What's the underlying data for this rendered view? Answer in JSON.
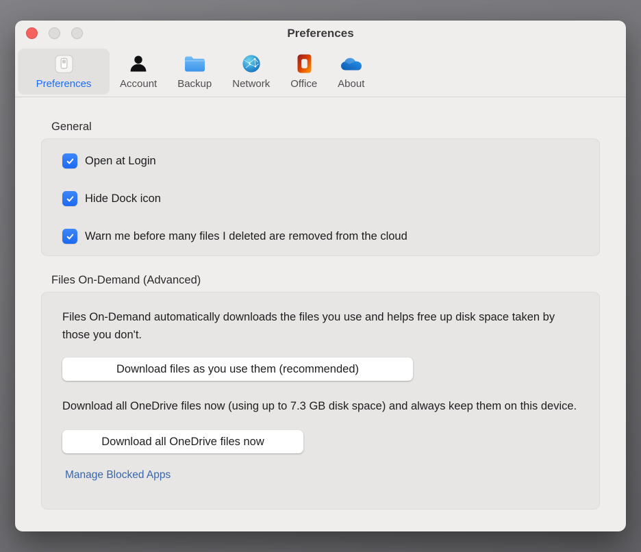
{
  "window": {
    "title": "Preferences"
  },
  "toolbar": {
    "tabs": [
      {
        "label": "Preferences",
        "icon": "switch-icon",
        "selected": true
      },
      {
        "label": "Account",
        "icon": "person-icon",
        "selected": false
      },
      {
        "label": "Backup",
        "icon": "folder-icon",
        "selected": false
      },
      {
        "label": "Network",
        "icon": "globe-icon",
        "selected": false
      },
      {
        "label": "Office",
        "icon": "office-logo-icon",
        "selected": false
      },
      {
        "label": "About",
        "icon": "onedrive-cloud-icon",
        "selected": false
      }
    ]
  },
  "general": {
    "section_title": "General",
    "checkboxes": [
      {
        "label": "Open at Login",
        "checked": true
      },
      {
        "label": "Hide Dock icon",
        "checked": true
      },
      {
        "label": "Warn me before many files I deleted are removed from the cloud",
        "checked": true
      }
    ]
  },
  "files_on_demand": {
    "section_title": "Files On-Demand (Advanced)",
    "description_1": "Files On-Demand automatically downloads the files you use and helps free up disk space taken by those you don't.",
    "button_download_as_used": "Download files as you use them (recommended)",
    "description_2": "Download all OneDrive files now (using up to 7.3 GB disk space) and always keep them on this device.",
    "button_download_all": "Download all OneDrive files now",
    "manage_blocked_apps_link": "Manage Blocked Apps"
  },
  "colors": {
    "selected_tab_label": "#1a6dfe",
    "checkbox_blue": "#1d6af2",
    "link_blue": "#3766ae",
    "window_bg": "#efeeec",
    "panel_bg": "#e7e6e4",
    "close_light": "#f5615d"
  }
}
